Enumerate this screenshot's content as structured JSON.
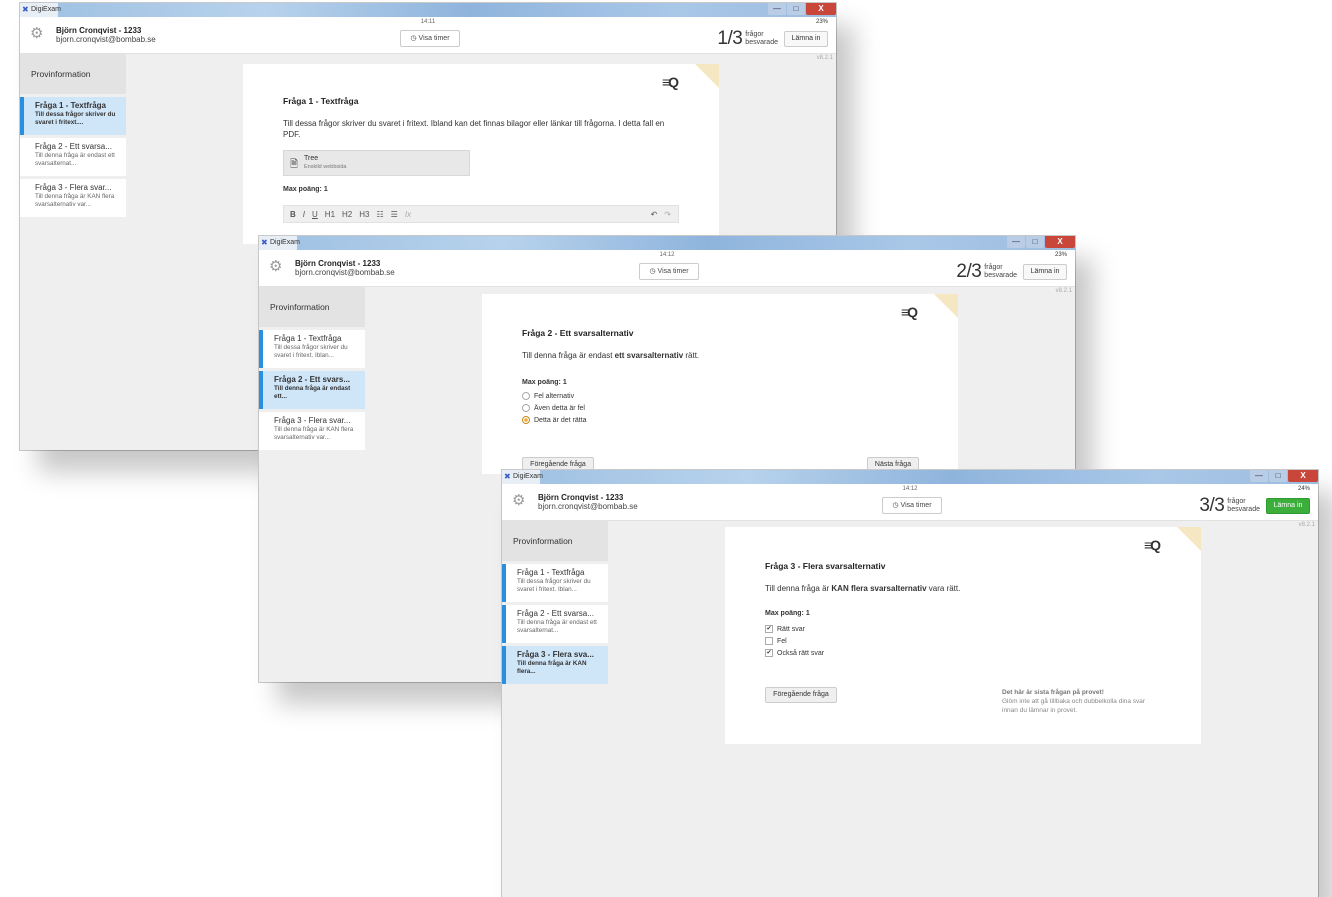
{
  "app": {
    "name": "DigiExam"
  },
  "user": {
    "name": "Björn Cronqvist - 1233",
    "email": "bjorn.cronqvist@bombab.se"
  },
  "ui": {
    "timer_label": "Visa timer",
    "progress_label_1": "frågor",
    "progress_label_2": "besvarade",
    "submit_label": "Lämna in",
    "version": "v8.2.1",
    "sidebar_info": "Provinformation",
    "max_points": "Max poäng: 1",
    "prev_button": "Föregående fråga",
    "next_button": "Nästa fråga",
    "window_minimize": "—",
    "window_maximize": "□",
    "window_close": "X"
  },
  "windows": [
    {
      "clock": "14:11",
      "battery": "23%",
      "progress": "1/3",
      "sidebar": [
        {
          "title": "Fråga 1 - Textfråga",
          "desc": "Till dessa frågor skriver du svaret i fritext...."
        },
        {
          "title": "Fråga 2 - Ett svarsa...",
          "desc": "Till denna fråga är endast ett svarsalternat..."
        },
        {
          "title": "Fråga 3 - Flera svar...",
          "desc": "Till denna fråga är KAN flera svarsalternativ var..."
        }
      ],
      "question": {
        "title": "Fråga 1 - Textfråga",
        "text": "Till dessa frågor skriver du svaret i fritext. Ibland kan det finnas bilagor eller länkar till frågorna. I detta fall en PDF.",
        "attachment_title": "Tree",
        "attachment_sub": "Enskild webbsida"
      },
      "toolbar": [
        "B",
        "I",
        "U",
        "H1",
        "H2",
        "H3",
        "☷",
        "☰",
        "Ix",
        "↶",
        "↷"
      ]
    },
    {
      "clock": "14:12",
      "battery": "23%",
      "progress": "2/3",
      "sidebar": [
        {
          "title": "Fråga 1 - Textfråga",
          "desc": "Till dessa frågor skriver du svaret i fritext. Iblan..."
        },
        {
          "title": "Fråga 2 - Ett svars...",
          "desc": "Till denna fråga är endast ett..."
        },
        {
          "title": "Fråga 3 - Flera svar...",
          "desc": "Till denna fråga är KAN flera svarsalternativ var..."
        }
      ],
      "question": {
        "title": "Fråga 2 - Ett svarsalternativ",
        "text_pre": "Till denna fråga är endast ",
        "text_bold": "ett svarsalternativ",
        "text_post": " rätt.",
        "options": [
          "Fel alternativ",
          "Även detta är fel",
          "Detta är det rätta"
        ]
      }
    },
    {
      "clock": "14:12",
      "battery": "24%",
      "progress": "3/3",
      "sidebar": [
        {
          "title": "Fråga 1 - Textfråga",
          "desc": "Till dessa frågor skriver du svaret i fritext. Iblan..."
        },
        {
          "title": "Fråga 2 - Ett svarsa...",
          "desc": "Till denna fråga är endast ett svarsalternat..."
        },
        {
          "title": "Fråga 3 - Flera sva...",
          "desc": "Till denna fråga är KAN flera..."
        }
      ],
      "question": {
        "title": "Fråga 3 - Flera svarsalternativ",
        "text_pre": "Till denna fråga är ",
        "text_bold": "KAN flera svarsalternativ",
        "text_post": " vara rätt.",
        "options": [
          "Rätt svar",
          "Fel",
          "Också rätt svar"
        ],
        "last_note_title": "Det här är sista frågan på provet!",
        "last_note_text": "Glöm inte att gå tillbaka och dubbelkolla dina svar innan du lämnar in provet."
      }
    }
  ]
}
